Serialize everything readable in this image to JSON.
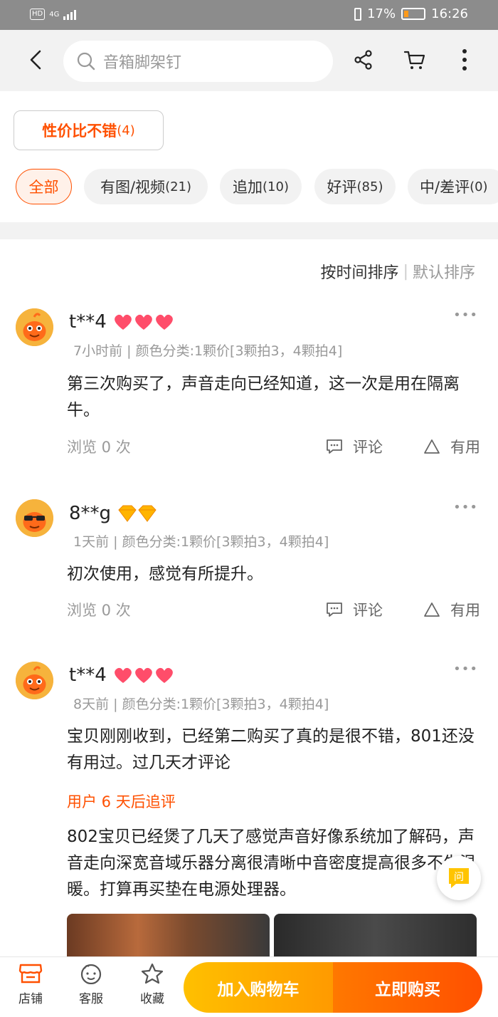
{
  "status_bar": {
    "hd": "HD",
    "network": "4G",
    "battery": "17%",
    "time": "16:26"
  },
  "header": {
    "search_placeholder": "音箱脚架钉"
  },
  "tag": {
    "label": "性价比不错",
    "count": "(4)"
  },
  "filters": [
    {
      "label": "全部",
      "count": "",
      "active": true
    },
    {
      "label": "有图/视频",
      "count": "(21)",
      "active": false
    },
    {
      "label": "追加",
      "count": "(10)",
      "active": false
    },
    {
      "label": "好评",
      "count": "(85)",
      "active": false
    },
    {
      "label": "中/差评",
      "count": "(0)",
      "active": false
    }
  ],
  "sort": {
    "time": "按时间排序",
    "separator": "|",
    "default": "默认排序"
  },
  "reviews": [
    {
      "user": "t**4",
      "badge": "heart",
      "meta": "7小时前 | 颜色分类:1颗价[3颗拍3，4颗拍4]",
      "text": "第三次购买了，声音走向已经知道，这一次是用在隔离牛。",
      "views": "浏览 0 次",
      "comment": "评论",
      "useful": "有用"
    },
    {
      "user": "8**g",
      "badge": "diamond",
      "meta": "1天前 | 颜色分类:1颗价[3颗拍3，4颗拍4]",
      "text": "初次使用，感觉有所提升。",
      "views": "浏览 0 次",
      "comment": "评论",
      "useful": "有用"
    },
    {
      "user": "t**4",
      "badge": "heart",
      "meta": "8天前 | 颜色分类:1颗价[3颗拍3，4颗拍4]",
      "text": "宝贝刚刚收到，已经第二购买了真的是很不错，801还没有用过。过几天才评论",
      "followup_label": "用户 6 天后追评",
      "followup_text": "802宝贝已经煲了几天了感觉声音好像系统加了解码，声音走向深宽音域乐器分离很清晰中音密度提高很多不失温暖。打算再买垫在电源处理器。"
    }
  ],
  "floating_button": {
    "label": "问"
  },
  "bottom_bar": {
    "shop": "店铺",
    "service": "客服",
    "favorite": "收藏",
    "add_to_cart": "加入购物车",
    "buy_now": "立即购买"
  },
  "colors": {
    "accent": "#ff5000",
    "cart_button": "#ffa800",
    "buy_button": "#ff5c00",
    "status_bar": "#8c8c8c"
  }
}
